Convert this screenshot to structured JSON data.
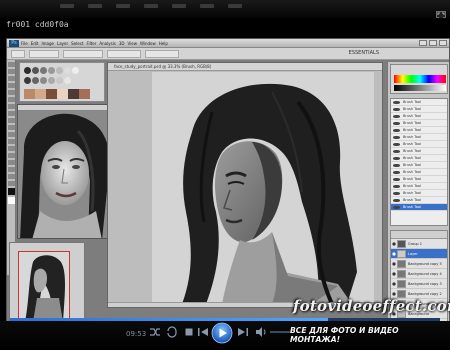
{
  "player": {
    "video_title": "fr001 cdd0f0a",
    "current_time": "09:53",
    "progress_fraction": 0.74,
    "accent_color": "#3b8cff"
  },
  "photoshop": {
    "menu": [
      "Ps",
      "File",
      "Edit",
      "Image",
      "Layer",
      "Select",
      "Filter",
      "Analysis",
      "3D",
      "View",
      "Window",
      "Help"
    ],
    "workspace": "ESSENTIALS",
    "document_tab": "face_study_portrait.psd @ 33.3% (Brush, RGB/8)",
    "brush_list_label": "Brush Tool",
    "brush_count": 16,
    "layers": [
      "Group 1",
      "Layer",
      "Background copy 5",
      "Background copy 4",
      "Background copy 3",
      "Background copy 2",
      "Background copy",
      "Background"
    ]
  },
  "watermark": {
    "site": "fotovideoeffect.com",
    "slogan": "ВСЕ ДЛЯ ФОТО И ВИДЕО МОНТАЖА!"
  },
  "icons": {
    "fullscreen": "fullscreen-icon",
    "shuffle": "shuffle-icon",
    "repeat": "repeat-icon",
    "stop": "stop-icon",
    "previous": "previous-icon",
    "play": "play-icon",
    "next": "next-icon",
    "mute": "volume-icon"
  }
}
